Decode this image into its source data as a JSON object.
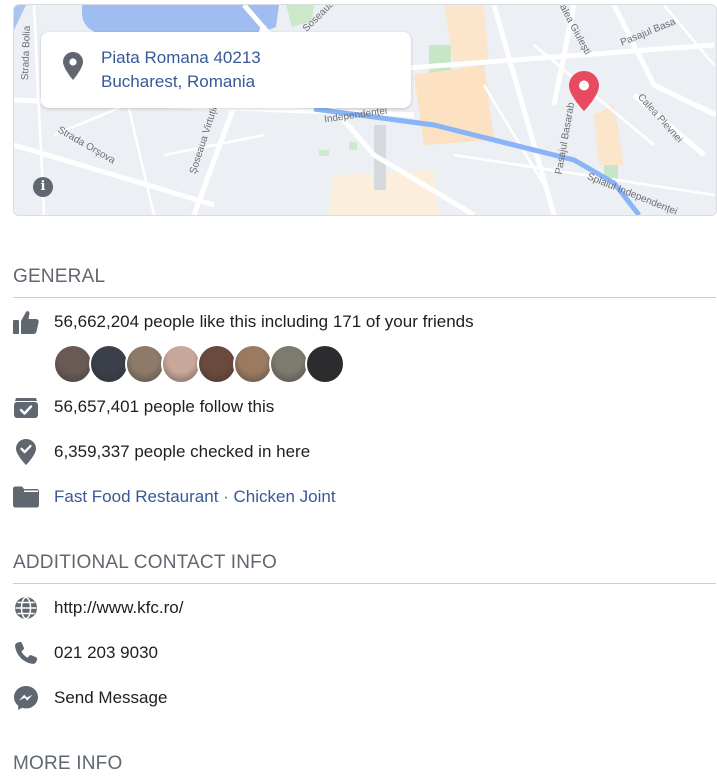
{
  "map": {
    "address_line1": "Piata Romana 40213",
    "address_line2": "Bucharest, Romania",
    "info_glyph": "i",
    "street_labels": [
      "Strada Bolia",
      "Strada Orșova",
      "Șoseaua Virtuții",
      "Soseaua",
      "Independenței",
      "Calea Giulești",
      "Pasajul Basarab",
      "Calea Plevnei",
      "Splaiul Independenței",
      "Pasajul Basa"
    ]
  },
  "general": {
    "title": "GENERAL",
    "likes": "56,662,204 people like this including 171 of your friends",
    "follows": "56,657,401 people follow this",
    "checkins": "6,359,337 people checked in here",
    "category1": "Fast Food Restaurant",
    "category_sep": " · ",
    "category2": "Chicken Joint",
    "friend_avatar_colors": [
      "#6a5a55",
      "#3a3f4a",
      "#8d7a68",
      "#c7a89a",
      "#6b4a3e",
      "#9a7b62",
      "#7d7a6e",
      "#2c2c2e"
    ]
  },
  "contact": {
    "title": "ADDITIONAL CONTACT INFO",
    "website": "http://www.kfc.ro/",
    "phone": "021 203 9030",
    "message": "Send Message"
  },
  "more": {
    "title": "MORE INFO"
  },
  "icons": {
    "like": "thumbs-up-icon",
    "follow": "follow-box-icon",
    "checkin": "location-check-icon",
    "category": "folder-icon",
    "website": "globe-icon",
    "phone": "phone-icon",
    "message": "messenger-icon"
  },
  "colors": {
    "link": "#385898",
    "icon": "#606770",
    "map_pin": "#e84a5f"
  }
}
